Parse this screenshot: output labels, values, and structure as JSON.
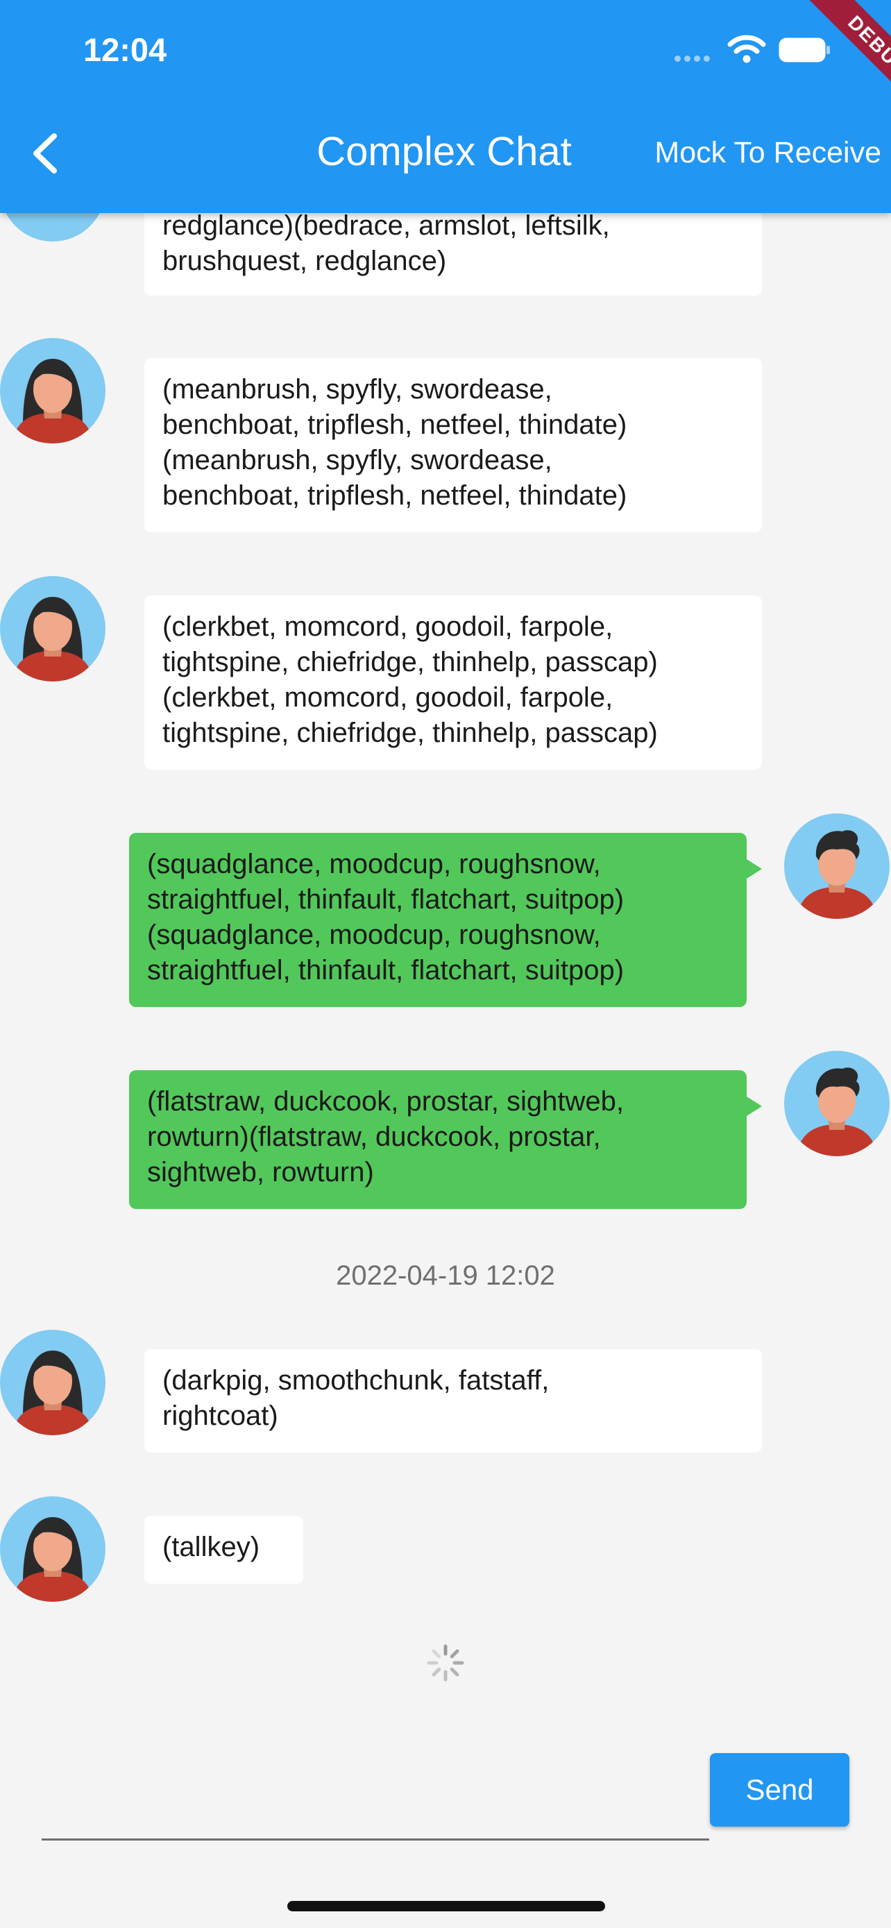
{
  "status_bar": {
    "time": "12:04",
    "debug_label": "DEBUG"
  },
  "header": {
    "back_icon": "chevron-left-icon",
    "title": "Complex Chat",
    "action_label": "Mock To Receive"
  },
  "messages": [
    {
      "side": "incoming",
      "avatar": "female-avatar",
      "text": "redglance)(bedrace, armslot, leftsilk,\nbrushquest, redglance)"
    },
    {
      "side": "incoming",
      "avatar": "female-avatar",
      "text": "(meanbrush, spyfly, swordease,\nbenchboat, tripflesh, netfeel, thindate)\n(meanbrush, spyfly, swordease,\nbenchboat, tripflesh, netfeel, thindate)"
    },
    {
      "side": "incoming",
      "avatar": "female-avatar",
      "text": "(clerkbet, momcord, goodoil, farpole,\ntightspine, chiefridge, thinhelp, passcap)\n(clerkbet, momcord, goodoil, farpole,\ntightspine, chiefridge, thinhelp, passcap)"
    },
    {
      "side": "outgoing",
      "avatar": "male-avatar",
      "text": "(squadglance, moodcup, roughsnow,\nstraightfuel, thinfault, flatchart, suitpop)\n(squadglance, moodcup, roughsnow,\nstraightfuel, thinfault, flatchart, suitpop)"
    },
    {
      "side": "outgoing",
      "avatar": "male-avatar",
      "text": "(flatstraw, duckcook, prostar, sightweb,\nrowturn)(flatstraw, duckcook, prostar,\nsightweb, rowturn)"
    },
    {
      "side": "incoming",
      "avatar": "female-avatar",
      "text": "(darkpig, smoothchunk, fatstaff,\nrightcoat)"
    },
    {
      "side": "incoming",
      "avatar": "female-avatar",
      "text": "(tallkey)"
    }
  ],
  "date_separator": "2022-04-19 12:02",
  "composer": {
    "send_label": "Send"
  },
  "colors": {
    "primary": "#2196f3",
    "outgoing_bubble": "#52c85a",
    "incoming_bubble": "#ffffff",
    "background": "#f4f4f4",
    "debug_banner": "#a01e3a"
  }
}
